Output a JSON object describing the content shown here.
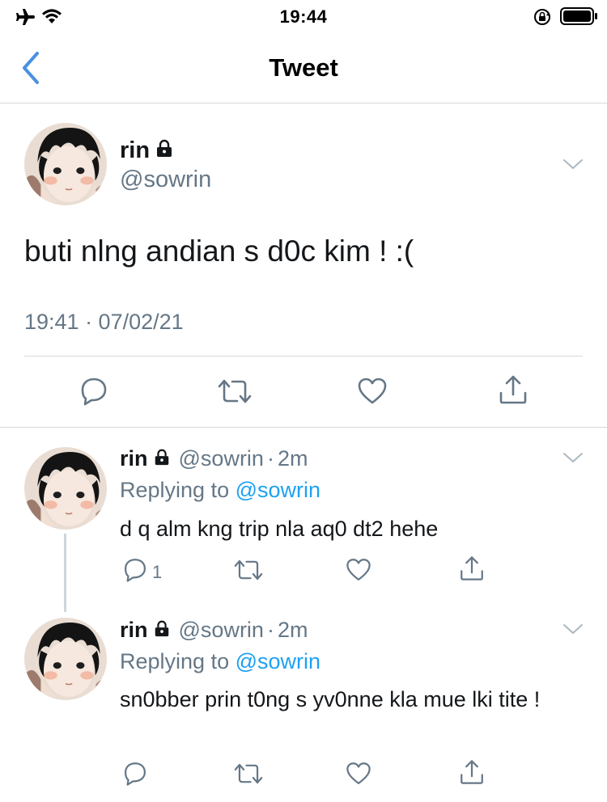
{
  "status_bar": {
    "time": "19:44",
    "left_icons": [
      "airplane-icon",
      "wifi-icon"
    ],
    "right_icons": [
      "orientation-lock-icon",
      "battery-icon"
    ]
  },
  "nav": {
    "title": "Tweet",
    "back_icon": "chevron-left-icon"
  },
  "main_tweet": {
    "display_name": "rin",
    "handle": "@sowrin",
    "text": "buti nlng andian s d0c kim ! :(",
    "timestamp": "19:41 · 07/02/21",
    "actions": {
      "reply_icon": "reply-icon",
      "retweet_icon": "retweet-icon",
      "like_icon": "like-icon",
      "share_icon": "share-icon"
    }
  },
  "replies": [
    {
      "display_name": "rin",
      "handle": "@sowrin",
      "separator": "·",
      "time": "2m",
      "replying_prefix": "Replying to",
      "replying_to": "@sowrin",
      "text": "d q alm kng trip nla aq0 dt2 hehe",
      "reply_count": "1"
    },
    {
      "display_name": "rin",
      "handle": "@sowrin",
      "separator": "·",
      "time": "2m",
      "replying_prefix": "Replying to",
      "replying_to": "@sowrin",
      "text": "sn0bber prin t0ng s yv0nne kla mue lki tite !",
      "reply_count": ""
    }
  ],
  "colors": {
    "accent": "#1da1f2",
    "muted": "#657786",
    "divider": "#d4d8db",
    "back_arrow": "#4a90e2"
  }
}
